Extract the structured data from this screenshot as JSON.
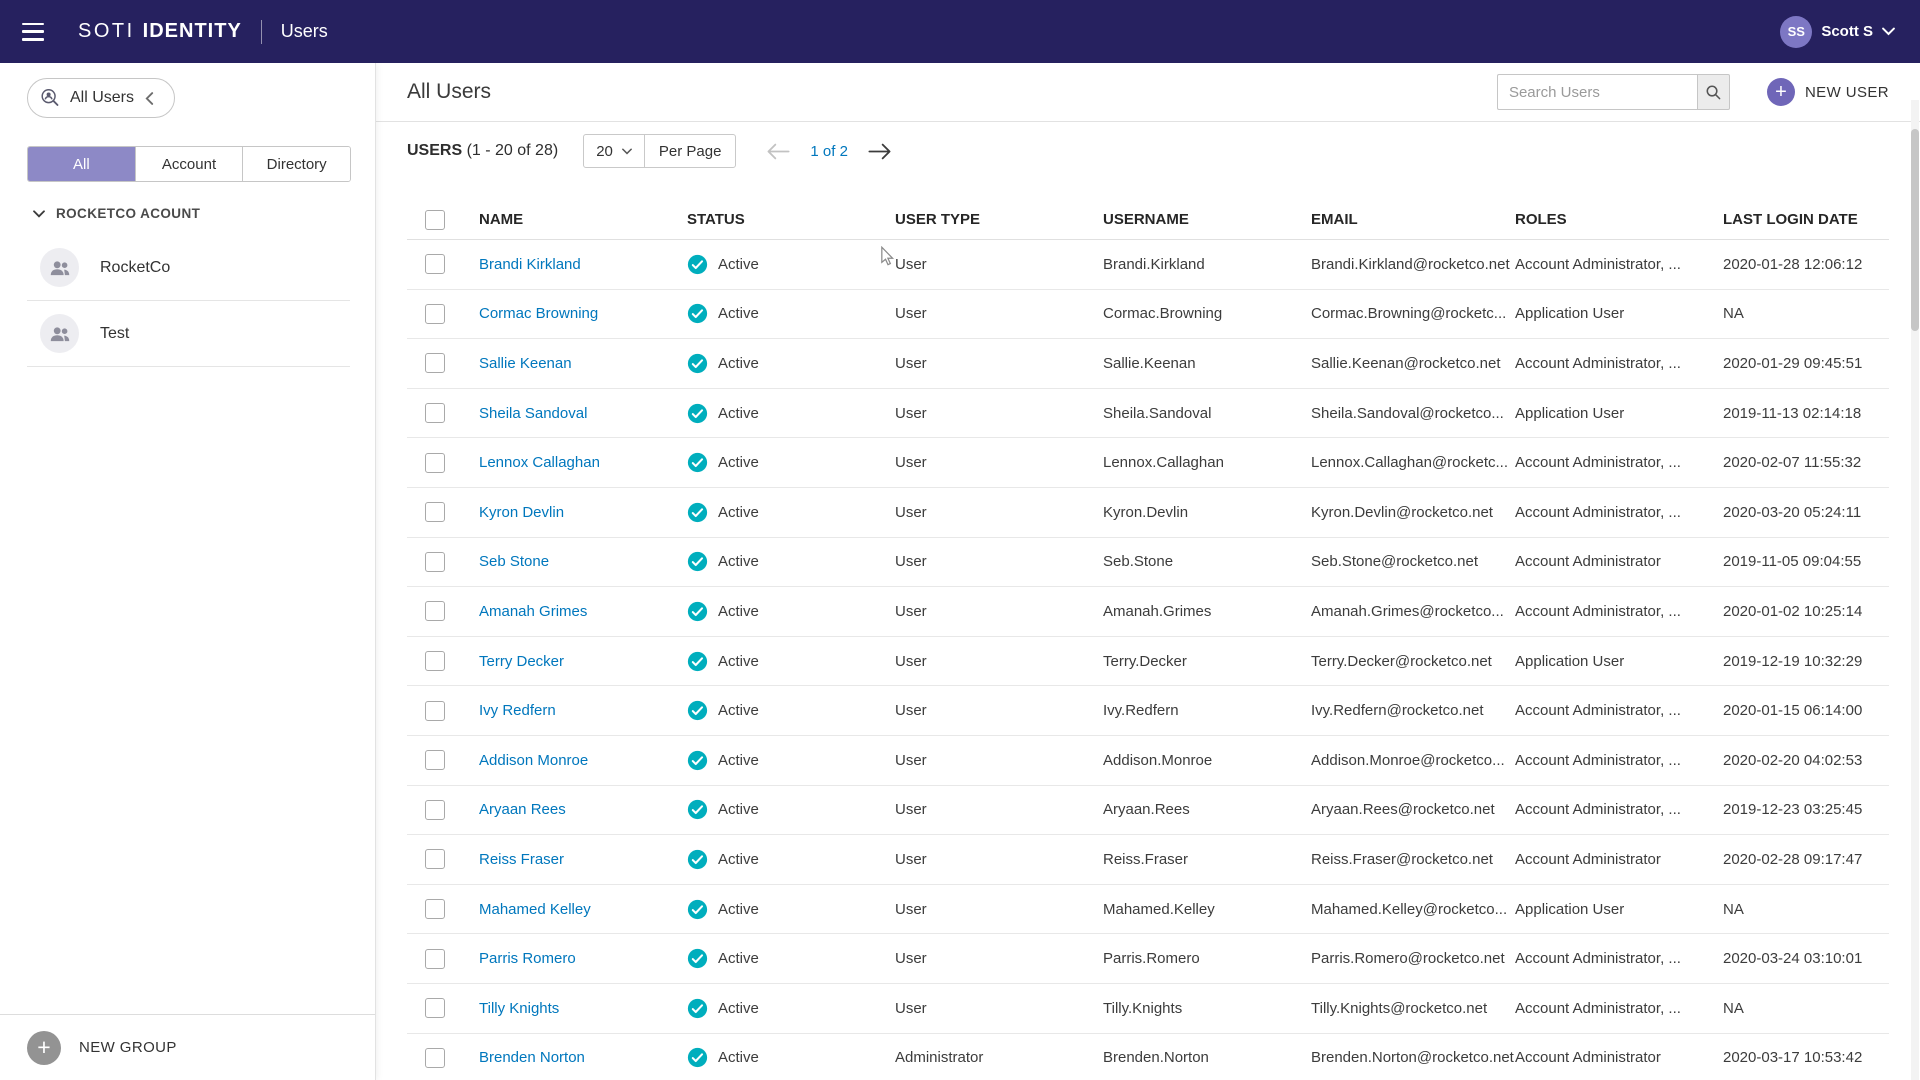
{
  "colors": {
    "topbar-bg": "#26215f",
    "accent-purple": "#8d89c6",
    "brand-purple": "#6f66b8",
    "avatar-purple": "#7d77c4",
    "link-blue": "#0077bd",
    "status-teal": "#00aebd"
  },
  "icons": {
    "menu": "hamburger",
    "filter": "person-magnifier",
    "collapse": "chevron-left",
    "section_expand": "chevron-down",
    "group_avatar": "two-people",
    "search": "magnifier",
    "add": "plus-circle",
    "prev": "arrow-left",
    "next": "arrow-right",
    "status_active": "check-circle",
    "select_caret": "chevron-down",
    "user_menu_caret": "chevron-down"
  },
  "topbar": {
    "brand_primary": "SOTI",
    "brand_secondary": "IDENTITY",
    "app_title": "Users",
    "user_initials": "SS",
    "user_name": "Scott S"
  },
  "sidebar": {
    "filter_pill_label": "All Users",
    "tabs": [
      {
        "label": "All",
        "selected": true
      },
      {
        "label": "Account",
        "selected": false
      },
      {
        "label": "Directory",
        "selected": false
      }
    ],
    "section_label": "ROCKETCO ACOUNT",
    "groups": [
      {
        "label": "RocketCo"
      },
      {
        "label": "Test"
      }
    ],
    "new_group_label": "NEW GROUP"
  },
  "main": {
    "title": "All Users",
    "search_placeholder": "Search Users",
    "new_user_label": "NEW USER",
    "toolbar": {
      "count_label": "USERS",
      "count_range": "(1 - 20 of 28)",
      "page_size": "20",
      "per_page_label": "Per Page",
      "page_indicator": "1 of 2"
    },
    "table": {
      "columns": [
        "NAME",
        "STATUS",
        "USER TYPE",
        "USERNAME",
        "EMAIL",
        "ROLES",
        "LAST LOGIN DATE"
      ],
      "rows": [
        {
          "name": "Brandi Kirkland",
          "status": "Active",
          "user_type": "User",
          "username": "Brandi.Kirkland",
          "email": "Brandi.Kirkland@rocketco.net",
          "roles": "Account Administrator, ...",
          "last_login": "2020-01-28 12:06:12"
        },
        {
          "name": "Cormac Browning",
          "status": "Active",
          "user_type": "User",
          "username": "Cormac.Browning",
          "email": "Cormac.Browning@rocketc...",
          "roles": "Application User",
          "last_login": "NA"
        },
        {
          "name": "Sallie Keenan",
          "status": "Active",
          "user_type": "User",
          "username": "Sallie.Keenan",
          "email": "Sallie.Keenan@rocketco.net",
          "roles": "Account Administrator, ...",
          "last_login": "2020-01-29 09:45:51"
        },
        {
          "name": "Sheila Sandoval",
          "status": "Active",
          "user_type": "User",
          "username": "Sheila.Sandoval",
          "email": "Sheila.Sandoval@rocketco...",
          "roles": "Application User",
          "last_login": "2019-11-13 02:14:18"
        },
        {
          "name": "Lennox Callaghan",
          "status": "Active",
          "user_type": "User",
          "username": "Lennox.Callaghan",
          "email": "Lennox.Callaghan@rocketc...",
          "roles": "Account Administrator, ...",
          "last_login": "2020-02-07 11:55:32"
        },
        {
          "name": "Kyron Devlin",
          "status": "Active",
          "user_type": "User",
          "username": "Kyron.Devlin",
          "email": "Kyron.Devlin@rocketco.net",
          "roles": "Account Administrator, ...",
          "last_login": "2020-03-20 05:24:11"
        },
        {
          "name": "Seb Stone",
          "status": "Active",
          "user_type": "User",
          "username": "Seb.Stone",
          "email": "Seb.Stone@rocketco.net",
          "roles": "Account Administrator",
          "last_login": "2019-11-05 09:04:55"
        },
        {
          "name": "Amanah Grimes",
          "status": "Active",
          "user_type": "User",
          "username": "Amanah.Grimes",
          "email": "Amanah.Grimes@rocketco...",
          "roles": "Account Administrator, ...",
          "last_login": "2020-01-02 10:25:14"
        },
        {
          "name": "Terry Decker",
          "status": "Active",
          "user_type": "User",
          "username": "Terry.Decker",
          "email": "Terry.Decker@rocketco.net",
          "roles": "Application User",
          "last_login": "2019-12-19 10:32:29"
        },
        {
          "name": "Ivy Redfern",
          "status": "Active",
          "user_type": "User",
          "username": "Ivy.Redfern",
          "email": "Ivy.Redfern@rocketco.net",
          "roles": "Account Administrator, ...",
          "last_login": "2020-01-15 06:14:00"
        },
        {
          "name": "Addison Monroe",
          "status": "Active",
          "user_type": "User",
          "username": "Addison.Monroe",
          "email": "Addison.Monroe@rocketco...",
          "roles": "Account Administrator, ...",
          "last_login": "2020-02-20 04:02:53"
        },
        {
          "name": "Aryaan Rees",
          "status": "Active",
          "user_type": "User",
          "username": "Aryaan.Rees",
          "email": "Aryaan.Rees@rocketco.net",
          "roles": "Account Administrator, ...",
          "last_login": "2019-12-23 03:25:45"
        },
        {
          "name": "Reiss Fraser",
          "status": "Active",
          "user_type": "User",
          "username": "Reiss.Fraser",
          "email": "Reiss.Fraser@rocketco.net",
          "roles": "Account Administrator",
          "last_login": "2020-02-28 09:17:47"
        },
        {
          "name": "Mahamed Kelley",
          "status": "Active",
          "user_type": "User",
          "username": "Mahamed.Kelley",
          "email": "Mahamed.Kelley@rocketco...",
          "roles": "Application User",
          "last_login": "NA"
        },
        {
          "name": "Parris Romero",
          "status": "Active",
          "user_type": "User",
          "username": "Parris.Romero",
          "email": "Parris.Romero@rocketco.net",
          "roles": "Account Administrator, ...",
          "last_login": "2020-03-24 03:10:01"
        },
        {
          "name": "Tilly Knights",
          "status": "Active",
          "user_type": "User",
          "username": "Tilly.Knights",
          "email": "Tilly.Knights@rocketco.net",
          "roles": "Account Administrator, ...",
          "last_login": "NA"
        },
        {
          "name": "Brenden Norton",
          "status": "Active",
          "user_type": "Administrator",
          "username": "Brenden.Norton",
          "email": "Brenden.Norton@rocketco.net",
          "roles": "Account Administrator",
          "last_login": "2020-03-17 10:53:42"
        }
      ]
    }
  }
}
